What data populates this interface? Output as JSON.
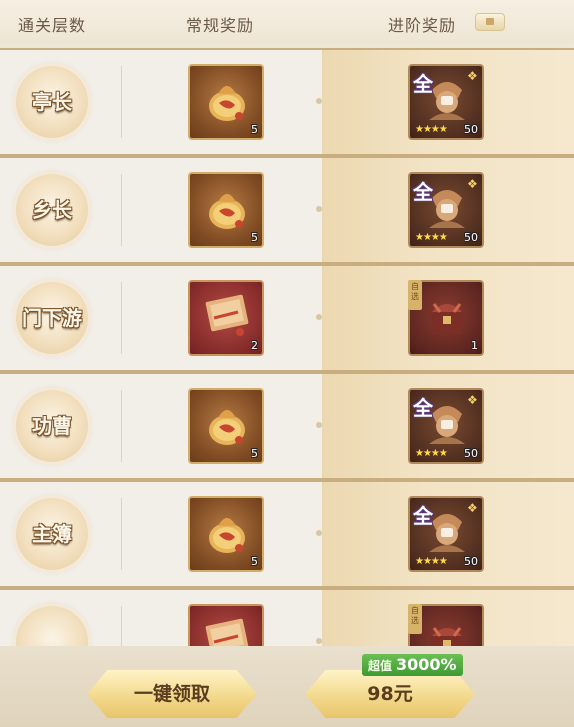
{
  "header": {
    "col_level": "通关层数",
    "col_regular": "常规奖励",
    "col_advanced": "进阶奖励",
    "advanced_lock_icon": "lock-icon"
  },
  "rows": [
    {
      "level": "亭长",
      "regular": {
        "icon": "gold-pouch-icon",
        "qty": "5",
        "bg": "brown"
      },
      "advanced": {
        "icon": "general-portrait-icon",
        "quan": "全",
        "stars": 4,
        "qty": "50",
        "bg": "dark"
      }
    },
    {
      "level": "乡长",
      "regular": {
        "icon": "gold-pouch-icon",
        "qty": "5",
        "bg": "brown"
      },
      "advanced": {
        "icon": "general-portrait-icon",
        "quan": "全",
        "stars": 4,
        "qty": "50",
        "bg": "dark"
      }
    },
    {
      "level": "门下游",
      "regular": {
        "icon": "red-packet-icon",
        "qty": "2",
        "bg": "red"
      },
      "advanced": {
        "icon": "treasure-chest-icon",
        "tag": "自选",
        "qty": "1",
        "bg": "darkred"
      }
    },
    {
      "level": "功曹",
      "regular": {
        "icon": "gold-pouch-icon",
        "qty": "5",
        "bg": "brown"
      },
      "advanced": {
        "icon": "general-portrait-icon",
        "quan": "全",
        "stars": 4,
        "qty": "50",
        "bg": "dark"
      }
    },
    {
      "level": "主簿",
      "regular": {
        "icon": "gold-pouch-icon",
        "qty": "5",
        "bg": "brown"
      },
      "advanced": {
        "icon": "general-portrait-icon",
        "quan": "全",
        "stars": 4,
        "qty": "50",
        "bg": "dark"
      }
    },
    {
      "level": "",
      "regular": {
        "icon": "red-packet-icon",
        "qty": "",
        "bg": "red"
      },
      "advanced": {
        "icon": "treasure-chest-icon",
        "tag": "自选",
        "qty": "",
        "bg": "darkred"
      }
    }
  ],
  "footer": {
    "claim_all_label": "一键领取",
    "price_label": "98元",
    "badge_prefix": "超值",
    "badge_value": "3000%"
  },
  "colors": {
    "accent_gold": "#f3d98d",
    "badge_green": "#4fa83c",
    "advanced_bg": "#f2e3c4"
  }
}
